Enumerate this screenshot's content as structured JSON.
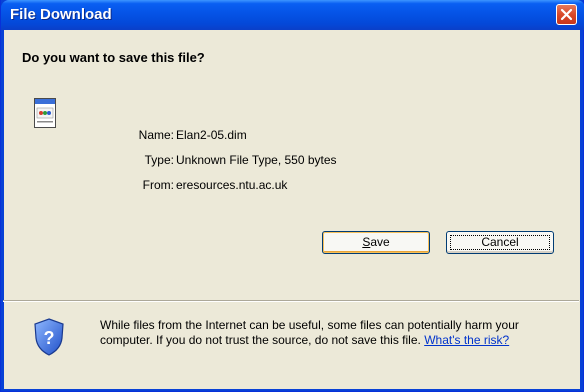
{
  "window": {
    "title": "File Download",
    "close_label": "Close"
  },
  "dialog": {
    "question": "Do you want to save this file?",
    "file_icon": "document-icon",
    "info": [
      {
        "label": "Name:",
        "value": "Elan2-05.dim"
      },
      {
        "label": "Type:",
        "value": "Unknown File Type, 550 bytes"
      },
      {
        "label": "From:",
        "value": "eresources.ntu.ac.uk"
      }
    ]
  },
  "buttons": {
    "save_first": "S",
    "save_rest": "ave",
    "cancel": "Cancel"
  },
  "warning": {
    "icon": "shield-question-icon",
    "text": "While files from the Internet can be useful, some files can potentially harm your computer. If you do not trust the source, do not save this file.",
    "link": "What's the risk?"
  },
  "colors": {
    "titlebar": "#0553e6",
    "close_button": "#d9492a",
    "dialog_bg": "#ece9d8",
    "link": "#0033cc"
  }
}
